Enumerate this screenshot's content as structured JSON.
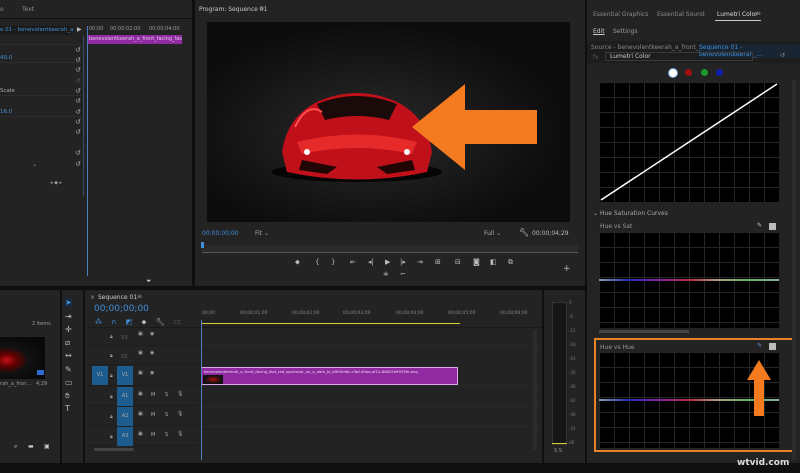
{
  "effect_controls": {
    "tabs": [
      "o",
      "Text"
    ],
    "source_header": "e 01 - benevolentkeerah_a_...",
    "mini_timecodes": [
      "00;00",
      "00;00;02;00",
      "00;00;04;00"
    ],
    "clip_label": "benevolentkeerah_a_front_facing_fast",
    "values": [
      "40.0",
      "16.0"
    ],
    "labels": [
      "Scale"
    ]
  },
  "program": {
    "title": "Program: Sequence 01",
    "timecode": "00;00;00;00",
    "zoom": "Fit",
    "quality": "Full",
    "duration": "00;00;04;29"
  },
  "lumetri": {
    "tabs": [
      "Essential Graphics",
      "Essential Sound",
      "Lumetri Color"
    ],
    "subtabs": [
      "Edit",
      "Settings"
    ],
    "source": "Source - benevolentkeerah_a_front_f...",
    "sequence": "Sequence 01 - benevolentkeerah_...",
    "effect": "Lumetri Color",
    "section": "Hue Saturation Curves",
    "curve1": "Hue vs Sat",
    "curve2": "Hue vs Hue",
    "accent": "#e8832a"
  },
  "project": {
    "count": "2 items",
    "item_name": "rah_a_fron...",
    "item_duration": "4;29"
  },
  "timeline": {
    "title": "Sequence 01",
    "timecode": "00;00;00;00",
    "ruler": [
      "00;00",
      "00;00;01;00",
      "00;00;02;00",
      "00;00;03;00",
      "00;00;04;00",
      "00;00;05;00",
      "00;00;06;00"
    ],
    "tracks": [
      "V3",
      "V2",
      "V1",
      "A1",
      "A2",
      "A3"
    ],
    "source_patch": "V1",
    "clip": "benevolentkeerah_a_front_facing_fast_red_sportscar_on_a_dark_bl_b9f45a6c-c3bf-40aa-af12-8d825a9933fe.png",
    "mute": "M",
    "solo": "S"
  },
  "meter": {
    "scale": [
      "0",
      "-6",
      "-12",
      "-18",
      "-24",
      "-30",
      "-36",
      "-42",
      "-48",
      "-54",
      "dB"
    ],
    "solo": "S S"
  },
  "watermark": "wtvid.com"
}
